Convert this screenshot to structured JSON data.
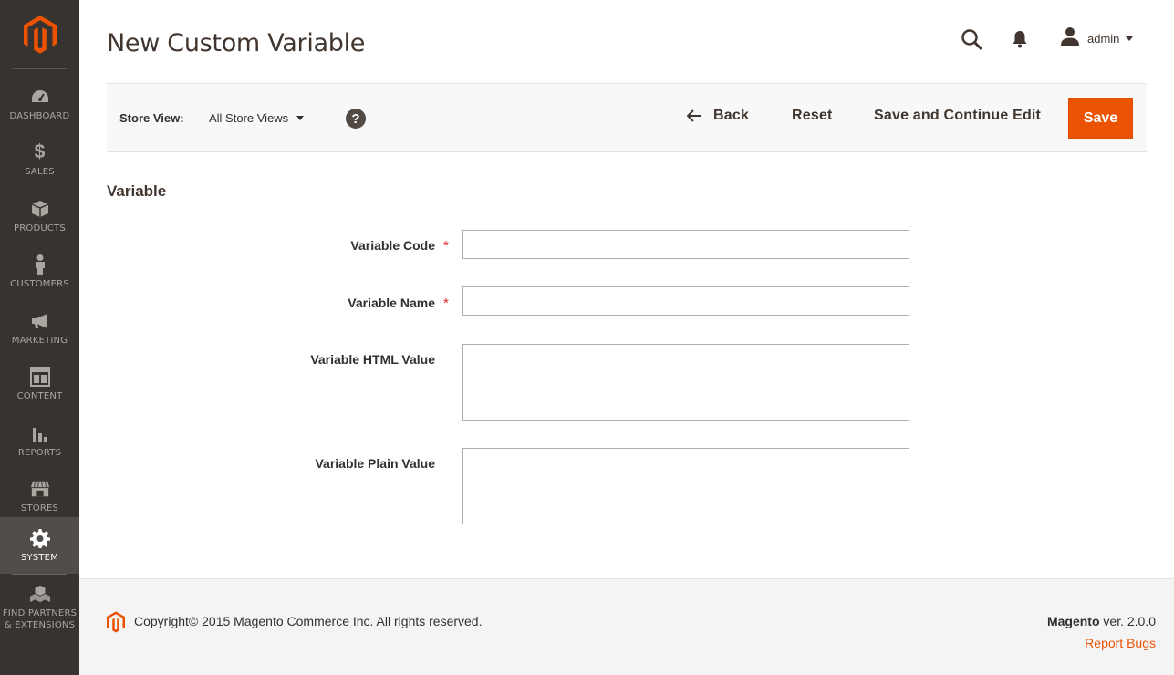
{
  "colors": {
    "sidebar_bg": "#373330",
    "sidebar_active": "#524d49",
    "accent": "#eb5202",
    "required": "#e22626"
  },
  "sidebar": {
    "logo": "magento-logo",
    "items": [
      {
        "label": "DASHBOARD",
        "icon": "dashboard-icon"
      },
      {
        "label": "SALES",
        "icon": "dollar-icon"
      },
      {
        "label": "PRODUCTS",
        "icon": "box-icon"
      },
      {
        "label": "CUSTOMERS",
        "icon": "person-icon"
      },
      {
        "label": "MARKETING",
        "icon": "megaphone-icon"
      },
      {
        "label": "CONTENT",
        "icon": "content-layout-icon"
      },
      {
        "label": "REPORTS",
        "icon": "bar-chart-icon"
      },
      {
        "label": "STORES",
        "icon": "storefront-icon"
      },
      {
        "label": "SYSTEM",
        "icon": "gear-icon",
        "active": true
      },
      {
        "label": "FIND PARTNERS\n& EXTENSIONS",
        "label_line1": "FIND PARTNERS",
        "label_line2": "& EXTENSIONS",
        "icon": "cubes-icon"
      }
    ]
  },
  "header": {
    "title": "New Custom Variable",
    "user": "admin"
  },
  "actionbar": {
    "store_view_label": "Store View:",
    "store_view_value": "All Store Views",
    "back": "Back",
    "reset": "Reset",
    "save_continue": "Save and Continue Edit",
    "save": "Save"
  },
  "form": {
    "section_title": "Variable",
    "required_mark": "*",
    "fields": [
      {
        "label": "Variable Code",
        "required": true,
        "value": ""
      },
      {
        "label": "Variable Name",
        "required": true,
        "value": ""
      },
      {
        "label": "Variable HTML Value",
        "required": false,
        "value": ""
      },
      {
        "label": "Variable Plain Value",
        "required": false,
        "value": ""
      }
    ]
  },
  "footer": {
    "copyright": "Copyright© 2015 Magento Commerce Inc. All rights reserved.",
    "brand": "Magento",
    "version": " ver. 2.0.0",
    "report_bugs": "Report Bugs"
  }
}
